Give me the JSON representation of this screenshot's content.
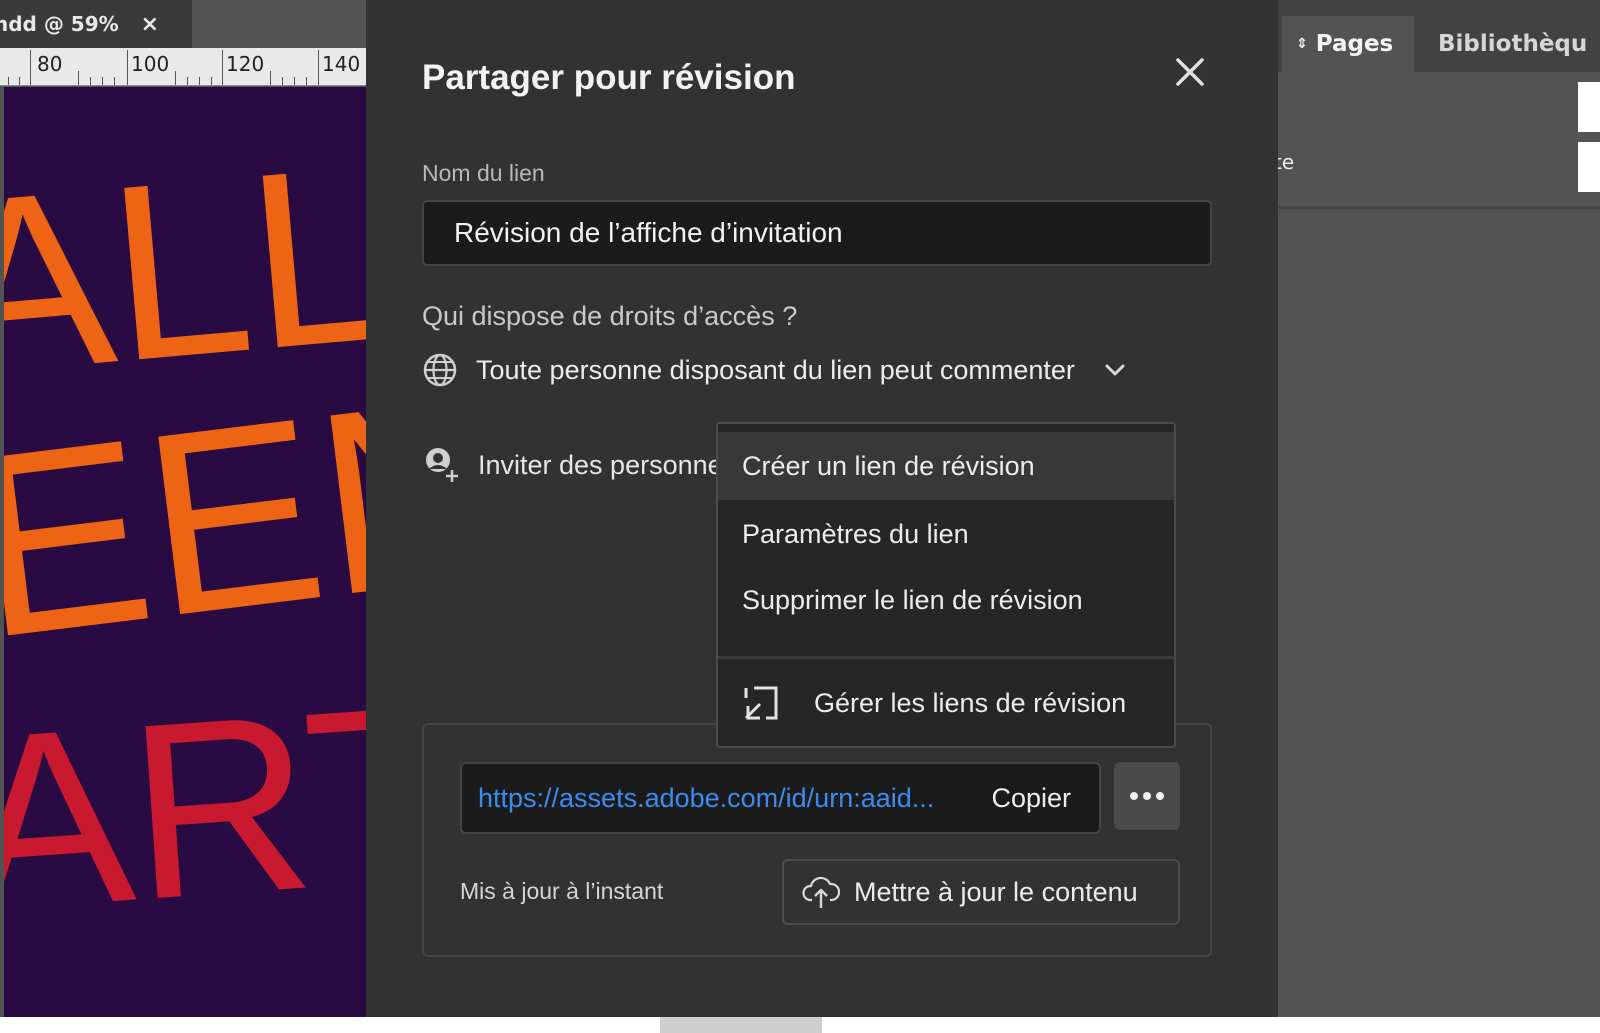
{
  "document": {
    "tab_label": "ndd @ 59%",
    "tab_close": "×",
    "ruler_labels": [
      "80",
      "100",
      "120",
      "140"
    ],
    "poster_lines": [
      "ALLO",
      "EEN",
      "ARTY"
    ]
  },
  "right_panel": {
    "tabs": [
      {
        "label": "Pages",
        "active": true
      },
      {
        "label": "Bibliothèqu",
        "active": false
      }
    ],
    "partial_text": "te"
  },
  "dialog": {
    "title": "Partager pour révision",
    "link_name_label": "Nom du lien",
    "link_name_value": "Révision de l’affiche d’invitation",
    "access_label": "Qui dispose de droits d’accès ?",
    "access_value": "Toute personne disposant du lien peut commenter",
    "invite_label": "Inviter des personne",
    "url": "https://assets.adobe.com/id/urn:aaid...",
    "copy_label": "Copier",
    "updated_status": "Mis à jour à l’instant",
    "update_button_label": "Mettre à jour le contenu"
  },
  "menu": {
    "items": [
      "Créer un lien de révision",
      "Paramètres du lien",
      "Supprimer le lien de révision"
    ],
    "manage_label": "Gérer les liens de révision"
  },
  "colors": {
    "dialog_bg": "#323232",
    "link_blue": "#3c8cf0",
    "poster_bg": "#2a0a43",
    "poster_orange": "#ec6414",
    "poster_red": "#c8192e"
  }
}
